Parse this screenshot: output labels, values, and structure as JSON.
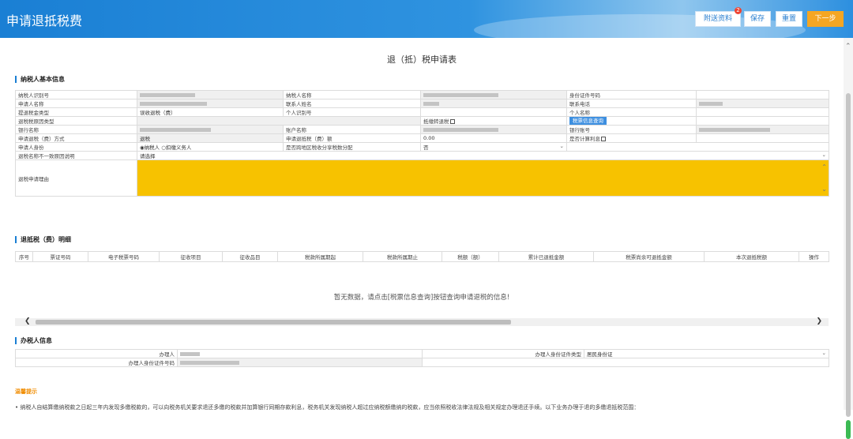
{
  "header": {
    "title": "申请退抵税费",
    "buttons": {
      "attach": "附送资料",
      "attach_badge": "2",
      "save": "保存",
      "reset": "重置",
      "next": "下一步"
    }
  },
  "form_title": "退（抵）税申请表",
  "section_basic": {
    "title": "纳税人基本信息",
    "labels": {
      "taxpayer_id": "纳税人识别号",
      "taxpayer_name": "纳税人名称",
      "id_type": "身份证件号码",
      "applicant_name": "申请人名称",
      "contact_name": "联系人姓名",
      "contact_phone": "联系电话",
      "refund_type": "提退税金类型",
      "personal_id": "个人识别号",
      "personal_name": "个人名称",
      "refund_reason_type": "退税税原因类型",
      "check_transfer": "抵缴转退税",
      "query_button": "税票信息查询",
      "bank_name": "银行名称",
      "account_name": "账户名称",
      "bank_account": "银行账号",
      "refund_method": "申请退税（费）方式",
      "refund_amount": "申请退抵税（费）额",
      "calc_interest": "是否计算利息",
      "applicant_identity": "申请人身份",
      "cross_region": "是否跨地区税收分享税数分配",
      "mismatch_reason": "退税名称不一致原因说明",
      "refund_reason_text": "退税申请理由"
    },
    "values": {
      "refund_type": "误收退税（费）",
      "refund_method": "退税",
      "refund_amount": "0.00",
      "identity_taxpayer": "纳税人",
      "identity_withholder": "扣缴义务人",
      "cross_region": "否",
      "mismatch_reason_placeholder": "请选择"
    }
  },
  "section_detail": {
    "title": "退抵税（费）明细",
    "columns": [
      "序号",
      "票证号码",
      "电子税票号码",
      "征收项目",
      "征收品目",
      "税款所属期起",
      "税款所属期止",
      "税额（额）",
      "累计已退抵金额",
      "税票尚余可退抵金额",
      "本次退抵税额",
      "操作"
    ],
    "empty_text": "暂无数据，请点击[税票信息查询]按钮查询申请退税的信息!"
  },
  "section_handler": {
    "title": "办税人信息",
    "labels": {
      "handler": "办理人",
      "id_type": "办理人身份证件类型",
      "id_number": "办理人身份证件号码"
    },
    "values": {
      "id_type": "居民身份证"
    }
  },
  "tips": {
    "title": "温馨提示",
    "text": "• 纳税人自结算缴纳税款之日起三年内发现多缴税款的，可以向税务机关要求退还多缴的税款并加算银行同期存款利息，税务机关发现纳税人超过应纳税额缴纳的税款，应当依照税收法律法规及相关规定办理退还手续。以下业务办理于退的多缴退抵税范围："
  },
  "colors": {
    "header": "#1a7fd4",
    "accent": "#f5a623",
    "reason_bg": "#f7c200"
  }
}
